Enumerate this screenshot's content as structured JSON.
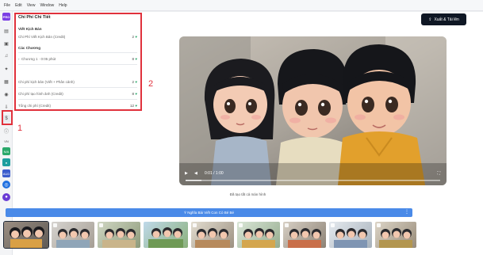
{
  "menubar": {
    "items": [
      "File",
      "Edit",
      "View",
      "Window",
      "Help"
    ]
  },
  "rail": {
    "logo_text": "PRO",
    "badges": [
      "VN",
      "N/A",
      "AUD"
    ]
  },
  "panel": {
    "title": "Chi Phí Chi Tiết",
    "script_section": {
      "title": "Viết Kịch Bản",
      "row_label": "Chi Phí Viết Kịch Bản (Credit)",
      "row_value": "2"
    },
    "chapters_section": {
      "title": "Các Chương",
      "chapter_label": "Chương 1 · 0:05 phút",
      "chapter_value": "8"
    },
    "summary": [
      {
        "label": "Chi phí kịch bản (Viết + Phân cảnh)",
        "value": "2"
      },
      {
        "label": "Chi phí tạo hình ảnh (Credit)",
        "value": "8"
      },
      {
        "label": "Tổng chi phí (Credit)",
        "value": "12"
      }
    ]
  },
  "annotations": {
    "rail_marker": "1",
    "panel_marker": "2"
  },
  "export_button": {
    "label": "Xuất & Tải lên"
  },
  "video": {
    "time": "0:01 / 1:00"
  },
  "status": {
    "text": "Đã tạo tất cả màn hình"
  },
  "timeline": {
    "track_label": "Ý Nghĩa Bài Viết Con Cò Bé Bé"
  },
  "colors": {
    "accent": "#4a8ae8",
    "annotation": "#e0313c",
    "dark_button": "#0f1724",
    "credit_green": "#2aa86a"
  }
}
